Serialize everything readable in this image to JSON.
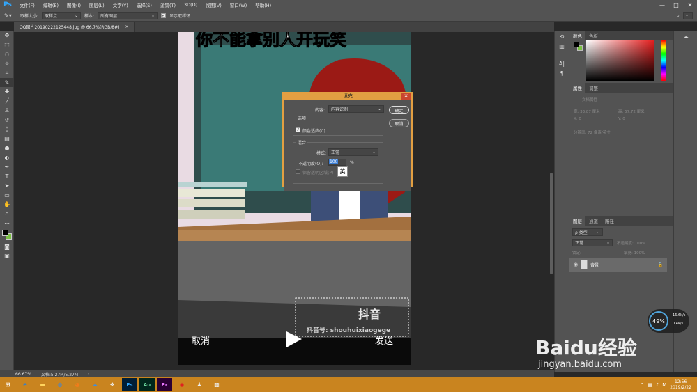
{
  "app": {
    "logo": "Ps"
  },
  "menu": [
    "文件(F)",
    "编辑(E)",
    "图像(I)",
    "图层(L)",
    "文字(Y)",
    "选择(S)",
    "滤镜(T)",
    "3D(D)",
    "视图(V)",
    "窗口(W)",
    "帮助(H)"
  ],
  "window_controls": [
    "—",
    "□",
    "✕"
  ],
  "options": {
    "sample_size_label": "取样大小:",
    "sample_size_value": "取样点",
    "sample_label": "样本:",
    "sample_value": "所有图层",
    "show_ring_label": "显示取样环"
  },
  "doc_tab": {
    "title": "QQ图片20190222125448.jpg @ 66.7%(RGB/8#)",
    "close": "×"
  },
  "status": {
    "zoom": "66.67%",
    "doc": "文档:5.27M/5.27M",
    "arrow": "›"
  },
  "canvas": {
    "overlay_cancel": "取消",
    "overlay_send": "发送",
    "tiktok_logo": "抖音",
    "tiktok_id": "抖音号: shouhuixiaogege",
    "top_caption": "你不能拿别人开玩笑"
  },
  "fill_dialog": {
    "title": "填充",
    "content_label": "内容:",
    "content_value": "内容识别",
    "ok": "确定",
    "cancel": "取消",
    "options_title": "选项",
    "color_adapt": "颜色适应(C)",
    "blend_title": "混合",
    "mode_label": "模式:",
    "mode_value": "正常",
    "opacity_label": "不透明度(O):",
    "opacity_value": "100",
    "opacity_unit": "%",
    "preserve_label": "保留透明区域(P)",
    "ime_char": "英"
  },
  "panels": {
    "color_tabs": [
      "颜色",
      "色板"
    ],
    "props_tabs": [
      "属性",
      "调整"
    ],
    "props_title": "文档属性",
    "props_w": "宽: 33.87 厘米",
    "props_h": "高: 57.72 厘米",
    "props_x": "X: 0",
    "props_y": "Y: 0",
    "props_res": "分辨率: 72 像素/英寸",
    "layers_tabs": [
      "图层",
      "通道",
      "路径"
    ],
    "layers_kind": "ρ 类型",
    "layers_mode": "正常",
    "layers_opacity": "不透明度: 100%",
    "layers_lock": "锁定:",
    "layers_fill": "填充: 100%",
    "layer_name": "背景",
    "lock_icon": "🔒",
    "fg_color": "#000000",
    "bg_color": "#7ac143"
  },
  "widget": {
    "percent": "49%",
    "up": "16.6k/s",
    "down": "0.4k/s"
  },
  "watermark": {
    "brand": "Baidu经验",
    "url": "jingyan.baidu.com"
  },
  "clock": {
    "time": "12:56",
    "date": "2019/2/22"
  },
  "taskbar_labels": {
    "ps": "Ps",
    "au": "Au",
    "pr": "Pr",
    "ime": "M"
  }
}
